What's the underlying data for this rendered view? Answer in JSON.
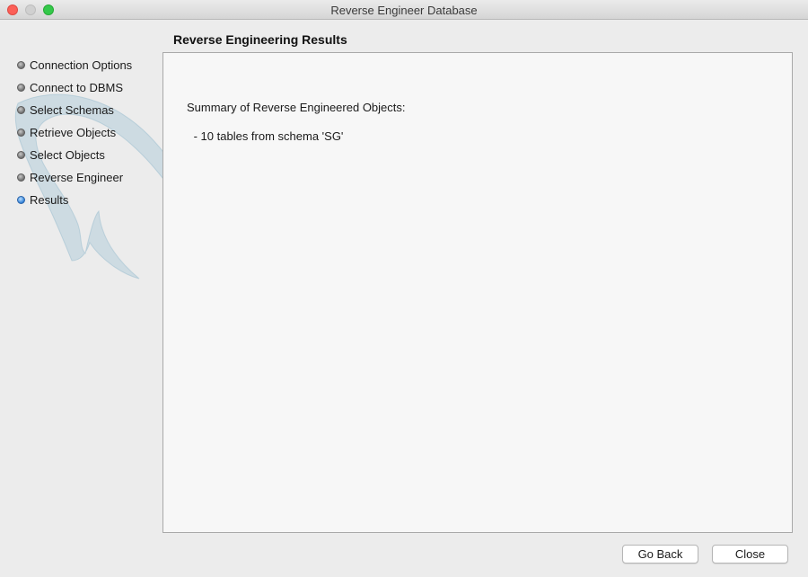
{
  "window": {
    "title": "Reverse Engineer Database"
  },
  "sidebar": {
    "steps": [
      {
        "label": "Connection Options",
        "active": false
      },
      {
        "label": "Connect to DBMS",
        "active": false
      },
      {
        "label": "Select Schemas",
        "active": false
      },
      {
        "label": "Retrieve Objects",
        "active": false
      },
      {
        "label": "Select Objects",
        "active": false
      },
      {
        "label": "Reverse Engineer",
        "active": false
      },
      {
        "label": "Results",
        "active": true
      }
    ]
  },
  "main": {
    "heading": "Reverse Engineering Results",
    "summary_title": "Summary of Reverse Engineered Objects:",
    "summary_lines": [
      " - 10 tables from schema 'SG'"
    ]
  },
  "footer": {
    "back_label": "Go Back",
    "close_label": "Close"
  },
  "colors": {
    "active_step": "#2f7fd6",
    "watermark": "#a8c8d8"
  },
  "icons": {
    "background": "mysql-dolphin-watermark"
  }
}
